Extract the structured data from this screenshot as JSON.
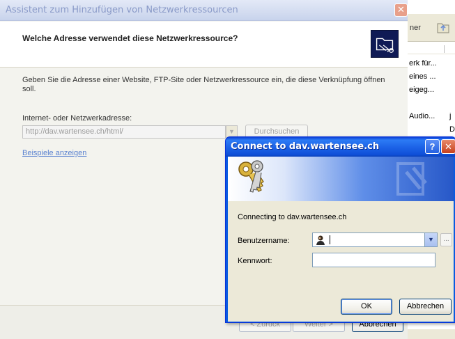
{
  "background_window": {
    "toolbar_text": "ner",
    "rows": [
      {
        "name": "erk für..."
      },
      {
        "name": "eines ..."
      },
      {
        "name": "eigeg..."
      },
      {
        "name": ""
      },
      {
        "name": "Audio...",
        "extra": "j"
      },
      {
        "name": "",
        "extra": "D"
      }
    ]
  },
  "wizard": {
    "title": "Assistent zum Hinzufügen von Netzwerkressourcen",
    "close_glyph": "✕",
    "question": "Welche Adresse verwendet diese Netzwerkressource?",
    "description": "Geben Sie die Adresse einer Website, FTP-Site oder Netzwerkressource ein, die diese Verknüpfung öffnen soll.",
    "address_label": "Internet- oder Netzwerkadresse:",
    "address_value": "http://dav.wartensee.ch/html/",
    "browse_label": "Durchsuchen",
    "examples_link": "Beispiele anzeigen",
    "back_label": "< Zurück",
    "next_label": "Weiter >",
    "cancel_label": "Abbrechen"
  },
  "dialog": {
    "title": "Connect to dav.wartensee.ch",
    "help_glyph": "?",
    "close_glyph": "✕",
    "connecting_text": "Connecting to dav.wartensee.ch",
    "username_label": "Benutzername:",
    "username_value": "",
    "password_label": "Kennwort:",
    "ok_label": "OK",
    "cancel_label": "Abbrechen",
    "browse_glyph": "..."
  },
  "colors": {
    "xp_title_blue": "#0a5be0",
    "link_blue": "#5a82d0",
    "close_red": "#c7401d",
    "dialog_face": "#ece9d8"
  }
}
